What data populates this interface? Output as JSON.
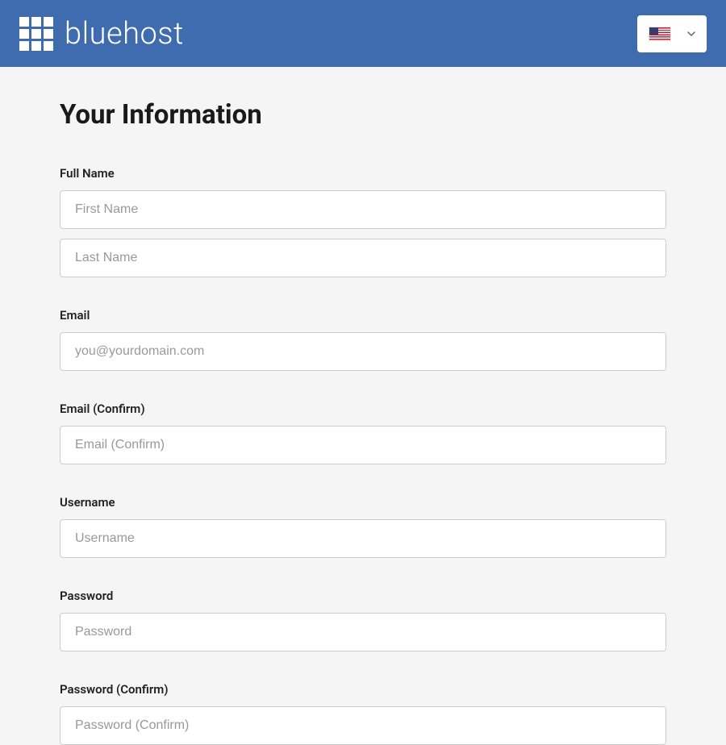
{
  "header": {
    "brand": "bluehost",
    "locale": "US"
  },
  "page": {
    "title": "Your Information"
  },
  "form": {
    "full_name": {
      "label": "Full Name",
      "first_placeholder": "First Name",
      "last_placeholder": "Last Name"
    },
    "email": {
      "label": "Email",
      "placeholder": "you@yourdomain.com"
    },
    "email_confirm": {
      "label": "Email (Confirm)",
      "placeholder": "Email (Confirm)"
    },
    "username": {
      "label": "Username",
      "placeholder": "Username"
    },
    "password": {
      "label": "Password",
      "placeholder": "Password"
    },
    "password_confirm": {
      "label": "Password (Confirm)",
      "placeholder": "Password (Confirm)"
    }
  }
}
